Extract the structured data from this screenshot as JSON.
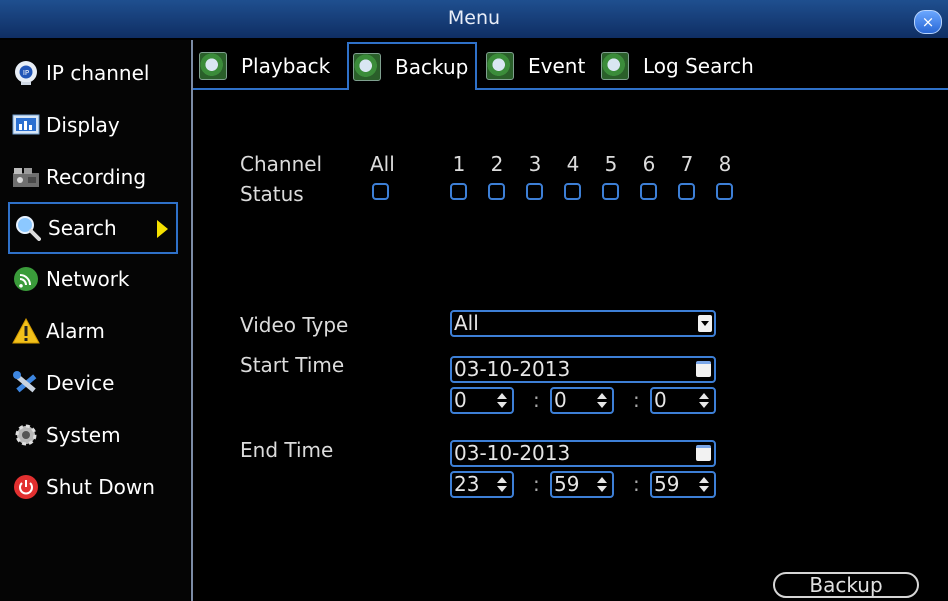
{
  "window": {
    "title": "Menu",
    "close_label": "×"
  },
  "sidebar": {
    "items": [
      {
        "label": "IP channel",
        "icon": "ip-channel-icon"
      },
      {
        "label": "Display",
        "icon": "display-icon"
      },
      {
        "label": "Recording",
        "icon": "recording-icon"
      },
      {
        "label": "Search",
        "icon": "search-icon"
      },
      {
        "label": "Network",
        "icon": "network-icon"
      },
      {
        "label": "Alarm",
        "icon": "alarm-icon"
      },
      {
        "label": "Device",
        "icon": "device-icon"
      },
      {
        "label": "System",
        "icon": "system-icon"
      },
      {
        "label": "Shut Down",
        "icon": "power-icon"
      }
    ],
    "active": "Search"
  },
  "tabs": [
    {
      "label": "Playback"
    },
    {
      "label": "Backup"
    },
    {
      "label": "Event"
    },
    {
      "label": "Log Search"
    }
  ],
  "active_tab": "Backup",
  "form": {
    "channel_label": "Channel",
    "status_label": "Status",
    "all_label": "All",
    "channels": [
      "1",
      "2",
      "3",
      "4",
      "5",
      "6",
      "7",
      "8"
    ],
    "video_type_label": "Video Type",
    "video_type_value": "All",
    "start_time_label": "Start Time",
    "start_date": "03-10-2013",
    "start_hour": "0",
    "start_minute": "0",
    "start_second": "0",
    "end_time_label": "End Time",
    "end_date": "03-10-2013",
    "end_hour": "23",
    "end_minute": "59",
    "end_second": "59",
    "time_separator": ":"
  },
  "actions": {
    "backup_label": "Backup"
  },
  "colors": {
    "accent": "#2f71c9",
    "title_bar": "#1f4f8f",
    "arrow": "#f5e000"
  }
}
